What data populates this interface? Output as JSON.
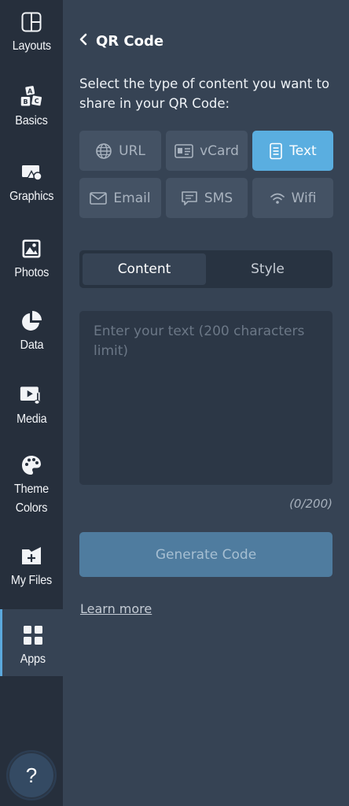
{
  "colors": {
    "rail_bg": "#262f3c",
    "panel_bg": "#364354",
    "accent": "#5aaee0",
    "button_bg": "#445264",
    "generate_bg": "#4f7c9f"
  },
  "sidebar": {
    "items": [
      {
        "label": "Layouts",
        "icon": "layout-icon"
      },
      {
        "label": "Basics",
        "icon": "abc-blocks-icon"
      },
      {
        "label": "Graphics",
        "icon": "shapes-icon"
      },
      {
        "label": "Photos",
        "icon": "image-icon"
      },
      {
        "label": "Data",
        "icon": "pie-chart-icon"
      },
      {
        "label": "Media",
        "icon": "video-music-icon"
      },
      {
        "label": "Theme Colors",
        "icon": "palette-icon"
      },
      {
        "label": "My Files",
        "icon": "folder-add-icon"
      },
      {
        "label": "Apps",
        "icon": "apps-grid-icon",
        "active": true
      }
    ],
    "help_label": "?"
  },
  "panel": {
    "back_icon": "chevron-left-icon",
    "title": "QR Code",
    "prompt": "Select the type of content you want to share in your QR Code:",
    "types": [
      {
        "label": "URL",
        "icon": "globe-icon"
      },
      {
        "label": "vCard",
        "icon": "id-card-icon"
      },
      {
        "label": "Text",
        "icon": "document-icon",
        "selected": true
      },
      {
        "label": "Email",
        "icon": "envelope-icon"
      },
      {
        "label": "SMS",
        "icon": "chat-bubble-icon"
      },
      {
        "label": "Wifi",
        "icon": "wifi-icon"
      }
    ],
    "tabs": [
      {
        "label": "Content",
        "active": true
      },
      {
        "label": "Style"
      }
    ],
    "textarea": {
      "placeholder": "Enter your text (200 characters limit)",
      "value": ""
    },
    "counter": "(0/200)",
    "generate_label": "Generate Code",
    "learn_more": "Learn more"
  }
}
